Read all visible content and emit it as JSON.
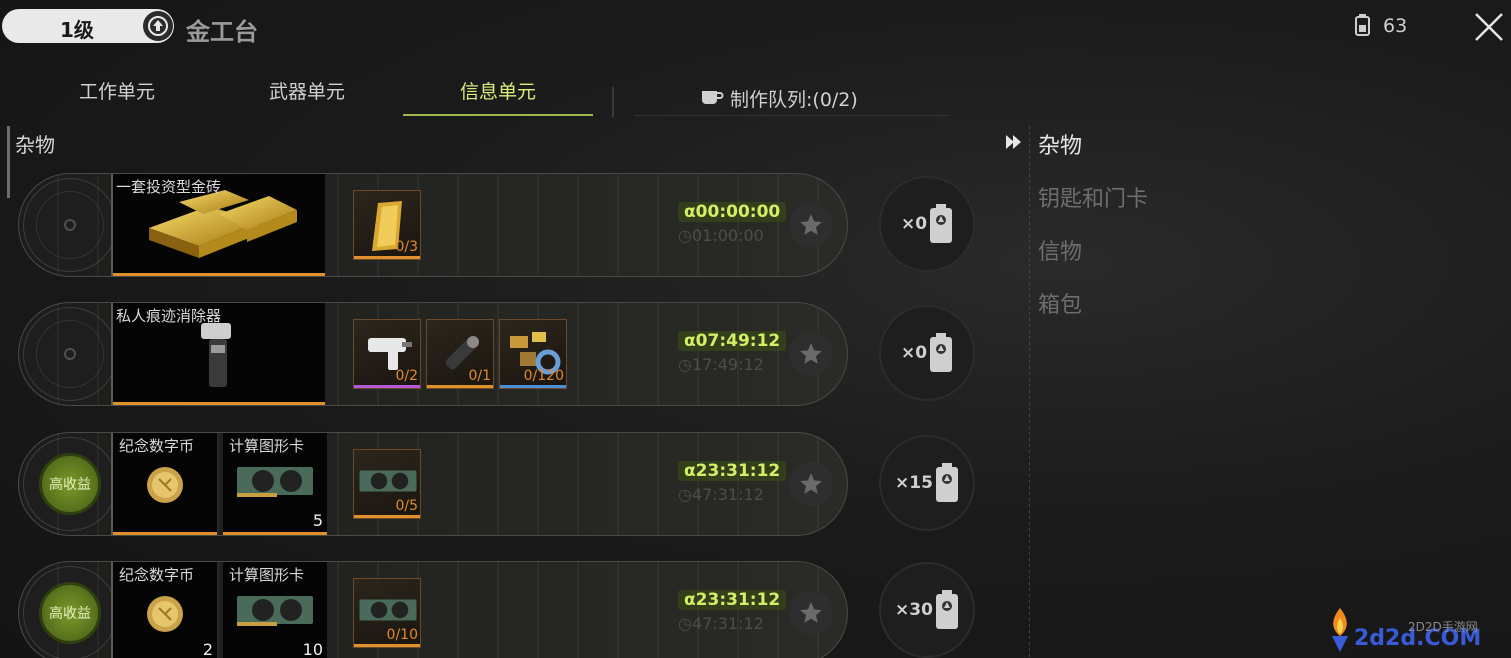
{
  "header": {
    "level": "1级",
    "title": "金工台",
    "energy_count": "63",
    "icons": {
      "upgrade": "upgrade-arrow-icon",
      "energy": "battery-icon",
      "close": "close-icon"
    }
  },
  "tabs": [
    {
      "label": "工作单元",
      "active": false
    },
    {
      "label": "武器单元",
      "active": false
    },
    {
      "label": "信息单元",
      "active": true
    }
  ],
  "queue": {
    "label": "制作队列:(0/2)",
    "icon": "cup-icon"
  },
  "section_title": "杂物",
  "rows": [
    {
      "high_yield": false,
      "badge": "",
      "products": [
        {
          "name": "一套投资型金砖",
          "qty": "",
          "icon": "gold-bars-icon"
        }
      ],
      "materials": [
        {
          "count": "0/3",
          "icon": "gold-bar-icon",
          "bar_color": "#e0902c"
        }
      ],
      "timer": "α00:00:00",
      "timer_sub": "01:00:00",
      "energy": "×0"
    },
    {
      "high_yield": false,
      "badge": "",
      "products": [
        {
          "name": "私人痕迹消除器",
          "qty": "",
          "icon": "eraser-device-icon"
        }
      ],
      "materials": [
        {
          "count": "0/2",
          "icon": "glue-gun-icon",
          "bar_color": "#b45ad6"
        },
        {
          "count": "0/1",
          "icon": "flashlight-icon",
          "bar_color": "#e0902c"
        },
        {
          "count": "0/120",
          "icon": "parts-pile-icon",
          "bar_color": "#4a8ed6"
        }
      ],
      "timer": "α07:49:12",
      "timer_sub": "17:49:12",
      "energy": "×0"
    },
    {
      "high_yield": true,
      "badge": "高收益",
      "products": [
        {
          "name": "纪念数字币",
          "qty": "",
          "icon": "coin-icon"
        },
        {
          "name": "计算图形卡",
          "qty": "5",
          "icon": "graphics-card-icon"
        }
      ],
      "materials": [
        {
          "count": "0/5",
          "icon": "graphics-card-icon",
          "bar_color": "#e0902c"
        }
      ],
      "timer": "α23:31:12",
      "timer_sub": "47:31:12",
      "energy": "×15"
    },
    {
      "high_yield": true,
      "badge": "高收益",
      "products": [
        {
          "name": "纪念数字币",
          "qty": "2",
          "icon": "coin-icon"
        },
        {
          "name": "计算图形卡",
          "qty": "10",
          "icon": "graphics-card-icon"
        }
      ],
      "materials": [
        {
          "count": "0/10",
          "icon": "graphics-card-icon",
          "bar_color": "#e0902c"
        }
      ],
      "timer": "α23:31:12",
      "timer_sub": "47:31:12",
      "energy": "×30"
    }
  ],
  "categories": [
    {
      "label": "杂物",
      "active": true
    },
    {
      "label": "钥匙和门卡",
      "active": false
    },
    {
      "label": "信物",
      "active": false
    },
    {
      "label": "箱包",
      "active": false
    }
  ],
  "watermark": {
    "site": "2d2d.COM",
    "name": "2D2D手游网"
  },
  "colors": {
    "accent": "#d8ee7a",
    "orange": "#e0902c",
    "badge_green": "#6b8a22"
  }
}
